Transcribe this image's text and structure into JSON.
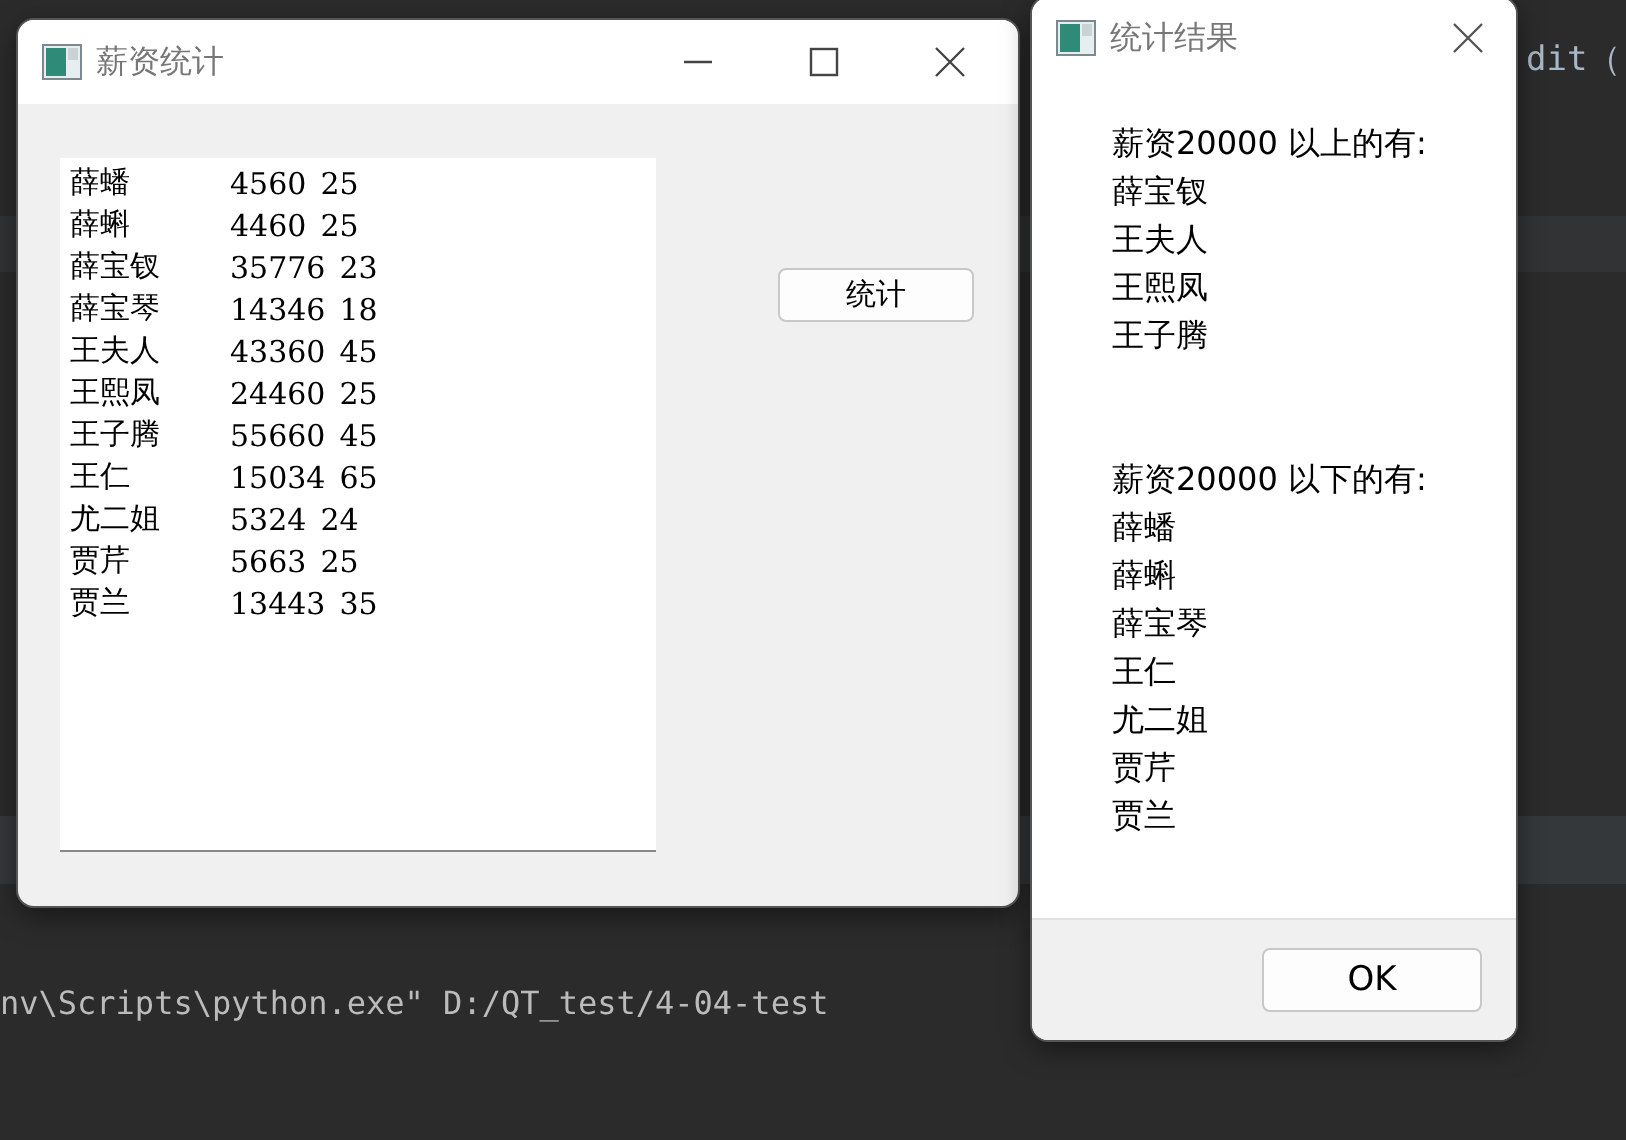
{
  "background_editor": {
    "code_fragment": "dit（",
    "console_line": "nv\\Scripts\\python.exe\" D:/QT_test/4-04-test"
  },
  "main_window": {
    "title": "薪资统计",
    "text_rows": [
      {
        "name": "薛蟠",
        "salary": "4560",
        "age": "25"
      },
      {
        "name": "薛蝌",
        "salary": "4460",
        "age": "25"
      },
      {
        "name": "薛宝钗",
        "salary": "35776",
        "age": "23"
      },
      {
        "name": "薛宝琴",
        "salary": "14346",
        "age": "18"
      },
      {
        "name": "王夫人",
        "salary": "43360",
        "age": "45"
      },
      {
        "name": "王熙凤",
        "salary": "24460",
        "age": "25"
      },
      {
        "name": "王子腾",
        "salary": "55660",
        "age": "45"
      },
      {
        "name": "王仁",
        "salary": "15034",
        "age": "65"
      },
      {
        "name": "尤二姐",
        "salary": "5324",
        "age": "24"
      },
      {
        "name": "贾芹",
        "salary": "5663",
        "age": "25"
      },
      {
        "name": "贾兰",
        "salary": "13443",
        "age": "35"
      }
    ],
    "button": "统计"
  },
  "dialog": {
    "title": "统计结果",
    "groups": [
      {
        "heading": "薪资20000 以上的有:",
        "names": [
          "薛宝钗",
          "王夫人",
          "王熙凤",
          "王子腾"
        ]
      },
      {
        "heading": "薪资20000 以下的有:",
        "names": [
          "薛蟠",
          "薛蝌",
          "薛宝琴",
          "王仁",
          "尤二姐",
          "贾芹",
          "贾兰"
        ]
      }
    ],
    "button": "OK"
  }
}
